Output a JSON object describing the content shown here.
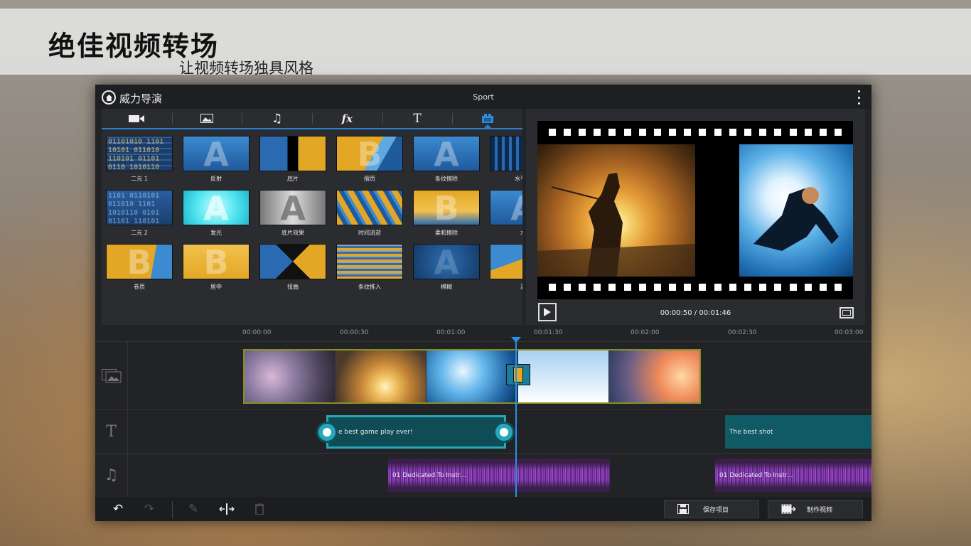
{
  "banner": {
    "title": "绝佳视频转场",
    "subtitle": "让视频转场独具风格"
  },
  "app": {
    "title": "威力导演",
    "project": "Sport"
  },
  "library": {
    "tabs": [
      "video-icon",
      "image-icon",
      "music-icon",
      "fx",
      "T",
      "transition-icon"
    ],
    "tab_fx": "fx",
    "tab_text": "T",
    "tiles": [
      "二元 1",
      "反射",
      "底片",
      "摺页",
      "条纹擦除",
      "水平滑",
      "二元 2",
      "发光",
      "底片效果",
      "时间流逝",
      "柔和擦除",
      "水",
      "卷页",
      "居中",
      "扭曲",
      "条纹推入",
      "模糊",
      "漩"
    ]
  },
  "preview": {
    "time": "00:00:50 / 00:01:46"
  },
  "timeline": {
    "ticks": [
      "00:00:00",
      "00:00:30",
      "00:01:00",
      "00:01:30",
      "00:02:00",
      "00:02:30",
      "00:03:00"
    ],
    "text_clip_1": "e best game play ever!",
    "text_clip_2": "The best shot",
    "audio_clip_1": "01 Dedicated To Instr...",
    "audio_clip_2": "01 Dedicated To Instr..."
  },
  "bottombar": {
    "save": "保存项目",
    "produce": "制作视频"
  },
  "colors": {
    "accent": "#2a8fe8",
    "text_clip": "#27a8b8",
    "audio": "#8a3fb4",
    "video_border": "#8a8e23"
  }
}
